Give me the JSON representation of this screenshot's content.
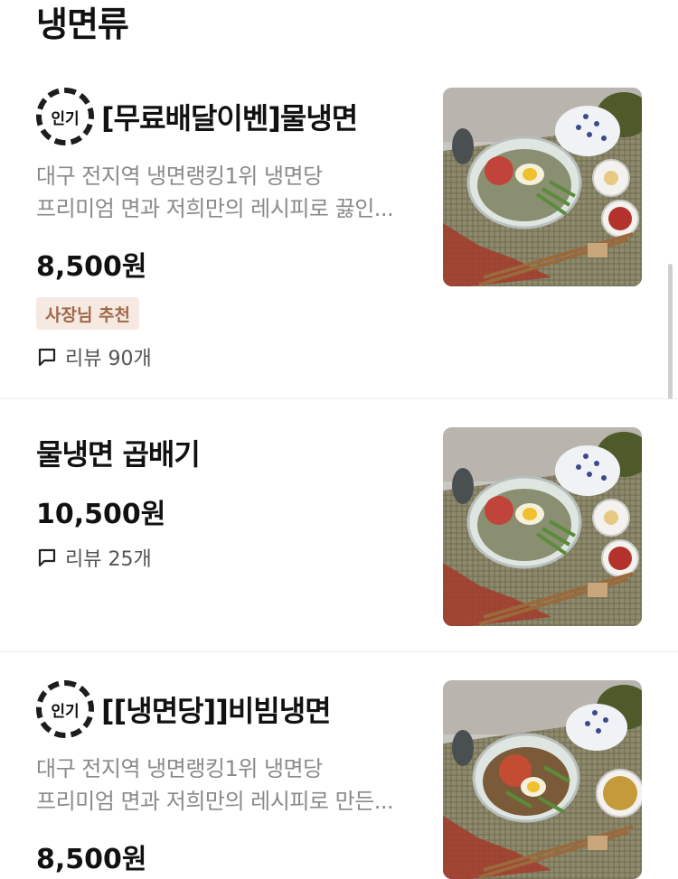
{
  "section": {
    "title": "냉면류"
  },
  "badge_label": "인기",
  "items": [
    {
      "name": "[무료배달이벤]물냉면",
      "desc_line1": "대구 전지역 냉면랭킹1위 냉면당",
      "desc_line2": "프리미엄 면과 저희만의 레시피로 끓인...",
      "price": "8,500원",
      "tag": "사장님 추천",
      "review": "리뷰 90개"
    },
    {
      "name": "물냉면 곱배기",
      "price": "10,500원",
      "review": "리뷰 25개"
    },
    {
      "name": "[[냉면당]]비빔냉면",
      "desc_line1": "대구 전지역 냉면랭킹1위 냉면당",
      "desc_line2": "프리미엄 면과 저희만의 레시피로 만든...",
      "price": "8,500원"
    }
  ],
  "colors": {
    "tag_bg": "#f5e9e1",
    "tag_text": "#a0694a",
    "desc_text": "#8a8a8a",
    "divider": "#ececec"
  }
}
